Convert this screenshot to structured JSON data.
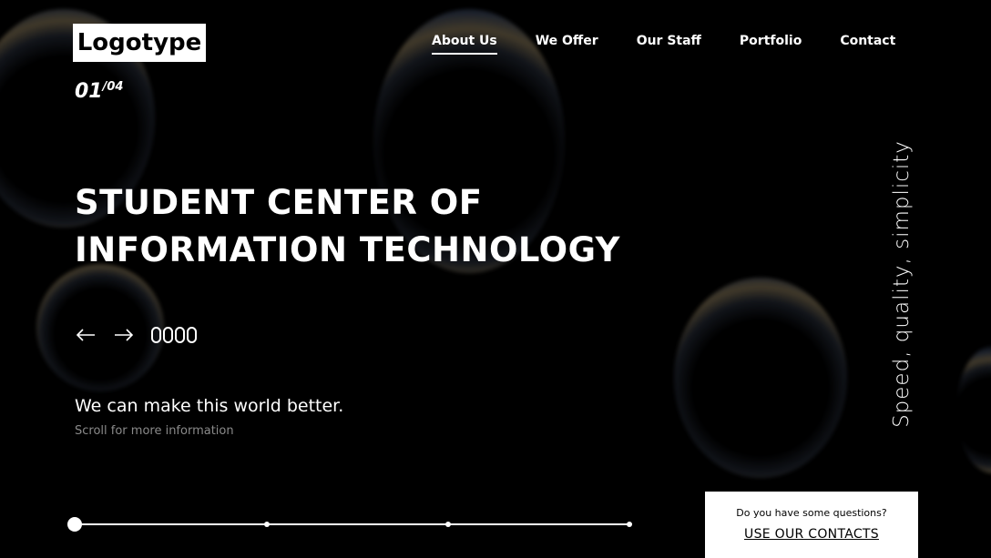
{
  "logo": "Logotype",
  "nav": [
    {
      "label": "About Us",
      "active": true
    },
    {
      "label": "We Offer"
    },
    {
      "label": "Our Staff"
    },
    {
      "label": "Portfolio"
    },
    {
      "label": "Contact"
    }
  ],
  "counter": {
    "current": "01",
    "total": "/04"
  },
  "headline": {
    "line1": "STUDENT CENTER OF",
    "line2": "INFORMATION TECHNOLOGY"
  },
  "controls": {
    "prev_icon": "arrow-left-icon",
    "next_icon": "arrow-right-icon"
  },
  "tagline": "We can make this world better.",
  "scroll_hint": "Scroll for more information",
  "vertical_text": "Speed, quality, simplicity",
  "slides": {
    "count": 4,
    "current": 1
  },
  "contact": {
    "question": "Do you have some questions?",
    "link": "USE OUR CONTACTS"
  },
  "colors": {
    "background": "#000000",
    "text": "#ffffff",
    "muted": "#8a8a8a"
  }
}
